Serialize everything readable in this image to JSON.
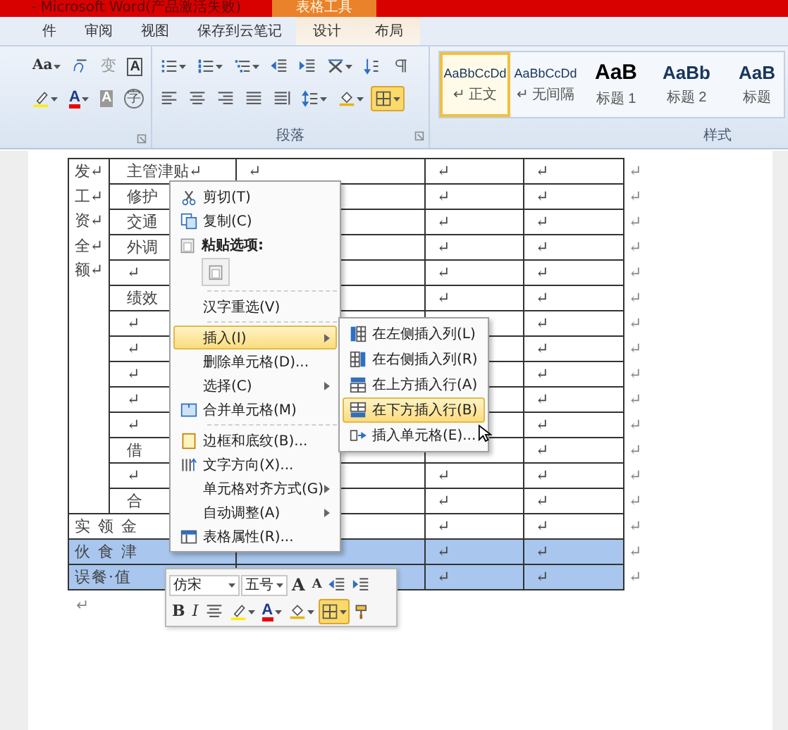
{
  "window": {
    "title": "- Microsoft Word(产品激活失败)",
    "context_tab_group": "表格工具"
  },
  "ribbon_tabs": [
    {
      "label": "件",
      "contextual": false
    },
    {
      "label": "审阅",
      "contextual": false
    },
    {
      "label": "视图",
      "contextual": false
    },
    {
      "label": "保存到云笔记",
      "contextual": false
    },
    {
      "label": "设计",
      "contextual": true
    },
    {
      "label": "布局",
      "contextual": true
    }
  ],
  "font_group": {
    "row_1": [
      {
        "kind": "case",
        "glyph": "Aa",
        "dropdown": true
      },
      {
        "kind": "phonetic",
        "dropdown": false
      },
      {
        "kind": "grey-char",
        "glyph": "变",
        "dropdown": false
      },
      {
        "kind": "boxed",
        "glyph": "A",
        "dropdown": false
      }
    ],
    "row_2": [
      {
        "kind": "highlight",
        "dropdown": true
      },
      {
        "kind": "font-color",
        "glyph": "A",
        "dropdown": true
      },
      {
        "kind": "shaded",
        "glyph": "A",
        "dropdown": false
      },
      {
        "kind": "circled",
        "glyph": "字",
        "dropdown": false
      }
    ]
  },
  "paragraph_group": {
    "label": "段落",
    "row_1": [
      {
        "kind": "bullets",
        "dropdown": true
      },
      {
        "kind": "numbering",
        "dropdown": true
      },
      {
        "kind": "multilevel",
        "dropdown": true
      },
      {
        "kind": "outdent",
        "dropdown": false
      },
      {
        "kind": "indent",
        "dropdown": false
      },
      {
        "kind": "asian-layout",
        "dropdown": true
      },
      {
        "kind": "sort",
        "dropdown": false
      },
      {
        "kind": "show-marks",
        "dropdown": false
      }
    ],
    "row_2": [
      {
        "kind": "align-left",
        "dropdown": false
      },
      {
        "kind": "center",
        "dropdown": false
      },
      {
        "kind": "align-right",
        "dropdown": false
      },
      {
        "kind": "justify",
        "dropdown": false
      },
      {
        "kind": "distribute",
        "dropdown": false
      },
      {
        "kind": "line-spacing",
        "dropdown": true
      },
      {
        "kind": "shading",
        "dropdown": true
      },
      {
        "kind": "borders",
        "dropdown": true,
        "selected": true
      }
    ]
  },
  "styles_group": {
    "label": "样式",
    "items": [
      {
        "preview": "AaBbCcDd",
        "label": "↵ 正文",
        "kind": "body",
        "selected": true
      },
      {
        "preview": "AaBbCcDd",
        "label": "↵ 无间隔",
        "kind": "body",
        "selected": false
      },
      {
        "preview": "AaB",
        "label": "标题 1",
        "kind": "heading-1",
        "selected": false
      },
      {
        "preview": "AaBb",
        "label": "标题 2",
        "kind": "heading-2",
        "selected": false
      },
      {
        "preview": "AaB",
        "label": "标题",
        "kind": "heading-2",
        "selected": false
      }
    ]
  },
  "table": {
    "first_column_lines": [
      "发↵",
      "工↵",
      "资↵",
      "全↵",
      "额↵"
    ],
    "rows": [
      {
        "kind": "item",
        "label": "主管津贴↵",
        "col_3": "↵",
        "col_4": "↵",
        "col_5": "↵",
        "end_mark": "↵",
        "selected": false
      },
      {
        "kind": "item",
        "label": "修护",
        "col_4": "↵",
        "col_5": "↵",
        "end_mark": "↵",
        "selected": false
      },
      {
        "kind": "item",
        "label": "交通",
        "col_4": "↵",
        "col_5": "↵",
        "end_mark": "↵",
        "selected": false
      },
      {
        "kind": "item",
        "label": "外调",
        "col_4": "↵",
        "col_5": "↵",
        "end_mark": "↵",
        "selected": false
      },
      {
        "kind": "item",
        "label": "↵",
        "col_4": "↵",
        "col_5": "↵",
        "end_mark": "↵",
        "selected": false
      },
      {
        "kind": "item",
        "label": "绩效",
        "col_4": "↵",
        "col_5": "↵",
        "end_mark": "↵",
        "selected": false
      },
      {
        "kind": "item",
        "label": "↵",
        "col_5": "↵",
        "end_mark": "↵",
        "selected": false
      },
      {
        "kind": "item",
        "label": "↵",
        "col_5": "↵",
        "end_mark": "↵",
        "selected": false
      },
      {
        "kind": "item",
        "label": "↵",
        "col_5": "↵",
        "end_mark": "↵",
        "selected": false
      },
      {
        "kind": "item",
        "label": "↵",
        "col_5": "↵",
        "end_mark": "↵",
        "selected": false
      },
      {
        "kind": "item",
        "label": "↵",
        "col_5": "↵",
        "end_mark": "↵",
        "selected": false
      },
      {
        "kind": "item",
        "label": "借",
        "col_5": "↵",
        "end_mark": "↵",
        "selected": false
      },
      {
        "kind": "item",
        "label": "↵",
        "col_4": "↵",
        "col_5": "↵",
        "end_mark": "↵",
        "selected": false
      },
      {
        "kind": "item",
        "label": "合",
        "col_4": "↵",
        "col_5": "↵",
        "end_mark": "↵",
        "selected": false
      },
      {
        "kind": "merged",
        "label": "实 领 金",
        "col_4": "↵",
        "col_5": "↵",
        "end_mark": "↵",
        "selected": false
      },
      {
        "kind": "merged",
        "label": "伙 食 津",
        "col_4": "↵",
        "col_5": "↵",
        "end_mark": "↵",
        "selected": true
      },
      {
        "kind": "merged",
        "label": "误餐·值",
        "col_4": "↵",
        "col_5": "↵",
        "end_mark": "↵",
        "selected": true
      }
    ],
    "after_mark": "↵"
  },
  "context_menu": [
    {
      "kind": "item",
      "label": "剪切(T)",
      "submenu": false,
      "highlighted": false
    },
    {
      "kind": "item",
      "label": "复制(C)",
      "submenu": false,
      "highlighted": false
    },
    {
      "kind": "heading",
      "label": "粘贴选项:"
    },
    {
      "kind": "paste-options"
    },
    {
      "kind": "separator"
    },
    {
      "kind": "item",
      "label": "汉字重选(V)",
      "submenu": false,
      "highlighted": false
    },
    {
      "kind": "separator"
    },
    {
      "kind": "item",
      "label": "插入(I)",
      "submenu": true,
      "highlighted": true
    },
    {
      "kind": "item",
      "label": "删除单元格(D)...",
      "submenu": false,
      "highlighted": false
    },
    {
      "kind": "item",
      "label": "选择(C)",
      "submenu": true,
      "highlighted": false
    },
    {
      "kind": "item",
      "label": "合并单元格(M)",
      "submenu": false,
      "highlighted": false
    },
    {
      "kind": "separator"
    },
    {
      "kind": "item",
      "label": "边框和底纹(B)...",
      "submenu": false,
      "highlighted": false
    },
    {
      "kind": "item",
      "label": "文字方向(X)...",
      "submenu": false,
      "highlighted": false
    },
    {
      "kind": "item",
      "label": "单元格对齐方式(G)",
      "submenu": true,
      "highlighted": false
    },
    {
      "kind": "item",
      "label": "自动调整(A)",
      "submenu": true,
      "highlighted": false
    },
    {
      "kind": "item",
      "label": "表格属性(R)...",
      "submenu": false,
      "highlighted": false
    }
  ],
  "insert_submenu": [
    {
      "label": "在左侧插入列(L)",
      "highlighted": false
    },
    {
      "label": "在右侧插入列(R)",
      "highlighted": false
    },
    {
      "label": "在上方插入行(A)",
      "highlighted": false
    },
    {
      "label": "在下方插入行(B)",
      "highlighted": true
    },
    {
      "label": "插入单元格(E)...",
      "highlighted": false
    }
  ],
  "mini_toolbar": {
    "font": "仿宋",
    "size": "五号",
    "row_1": [
      {
        "kind": "grow",
        "glyph": "A",
        "dropdown": false
      },
      {
        "kind": "shrink",
        "glyph": "A",
        "dropdown": false
      },
      {
        "kind": "outdent",
        "dropdown": false
      },
      {
        "kind": "indent",
        "dropdown": false
      }
    ],
    "row_2": [
      {
        "kind": "bold",
        "glyph": "B",
        "dropdown": false
      },
      {
        "kind": "italic",
        "glyph": "I",
        "dropdown": false
      },
      {
        "kind": "center",
        "dropdown": false
      },
      {
        "kind": "highlight",
        "dropdown": true
      },
      {
        "kind": "font-color",
        "glyph": "A",
        "dropdown": true
      },
      {
        "kind": "shading",
        "dropdown": true
      },
      {
        "kind": "borders",
        "dropdown": true,
        "selected": true
      },
      {
        "kind": "painter",
        "dropdown": false
      }
    ]
  }
}
